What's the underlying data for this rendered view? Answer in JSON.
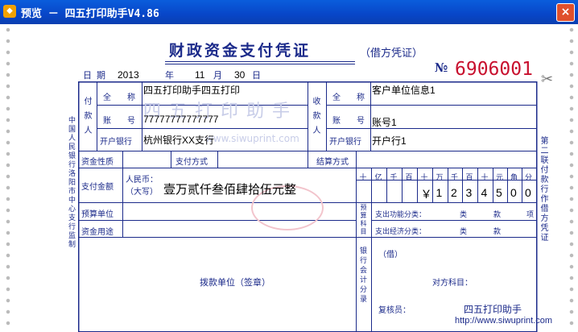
{
  "window": {
    "title": "预览 － 四五打印助手V4.86",
    "icon": "app-icon",
    "close_label": "×"
  },
  "voucher": {
    "title": "财政资金支付凭证",
    "subtitle": "（借方凭证）",
    "number_prefix": "№",
    "number": "6906001",
    "date": {
      "label": "日期",
      "year": "2013",
      "year_unit": "年",
      "month": "11",
      "month_unit": "月",
      "day": "30",
      "day_unit": "日"
    },
    "payer": {
      "section_label": "付款人",
      "name_label": "全　　称",
      "name": "四五打印助手四五打印",
      "account_label": "账　　号",
      "account": "77777777777777",
      "bank_label": "开户银行",
      "bank": "杭州银行XX支行"
    },
    "payee": {
      "section_label": "收款人",
      "name_label": "全　　称",
      "name": "客户单位信息1",
      "account_label": "账　　号",
      "account": "账号1",
      "bank_label": "开户银行",
      "bank": "开户行1"
    },
    "fund_nature_label": "资金性质",
    "payment_method_label": "支付方式",
    "settlement_method_label": "结算方式",
    "amount_label": "支付金额",
    "rmb_label": "人民币：",
    "daxie_label": "（大写）",
    "amount_upper": "壹万贰仟叁佰肆拾伍元整",
    "digit_units": [
      "十",
      "亿",
      "千",
      "百",
      "十",
      "万",
      "千",
      "百",
      "十",
      "元",
      "角",
      "分"
    ],
    "digits": [
      "",
      "",
      "",
      "",
      "￥",
      "1",
      "2",
      "3",
      "4",
      "5",
      "0",
      "0"
    ],
    "budget_unit_label": "预算单位",
    "fund_use_label": "资金用途",
    "budget_subject_label": "预算科目",
    "func_class_label": "支出功能分类：",
    "econ_class_label": "支出经济分类：",
    "class_label": "类",
    "kuan_label": "款",
    "xiang_label": "项",
    "bank_entry_label": "银行会计分录",
    "debit_label": "（借）",
    "credit_label": "对方科目：",
    "reviewer_label": "复核员：",
    "payer_seal_label": "拨款单位（签章）",
    "left_side_text": "中国人民银行洛阳市中心支行监制",
    "right_side_text": "第二联付款行作借方凭证",
    "watermark_brand": "四五打印助手",
    "watermark_url": "www.siwuprint.com",
    "bottom_brand": "四五打印助手",
    "bottom_url": "http://www.siwuprint.com"
  },
  "colors": {
    "ink": "#1b2a8a",
    "number_red": "#c8102e",
    "titlebar": "#0a5ddc"
  }
}
